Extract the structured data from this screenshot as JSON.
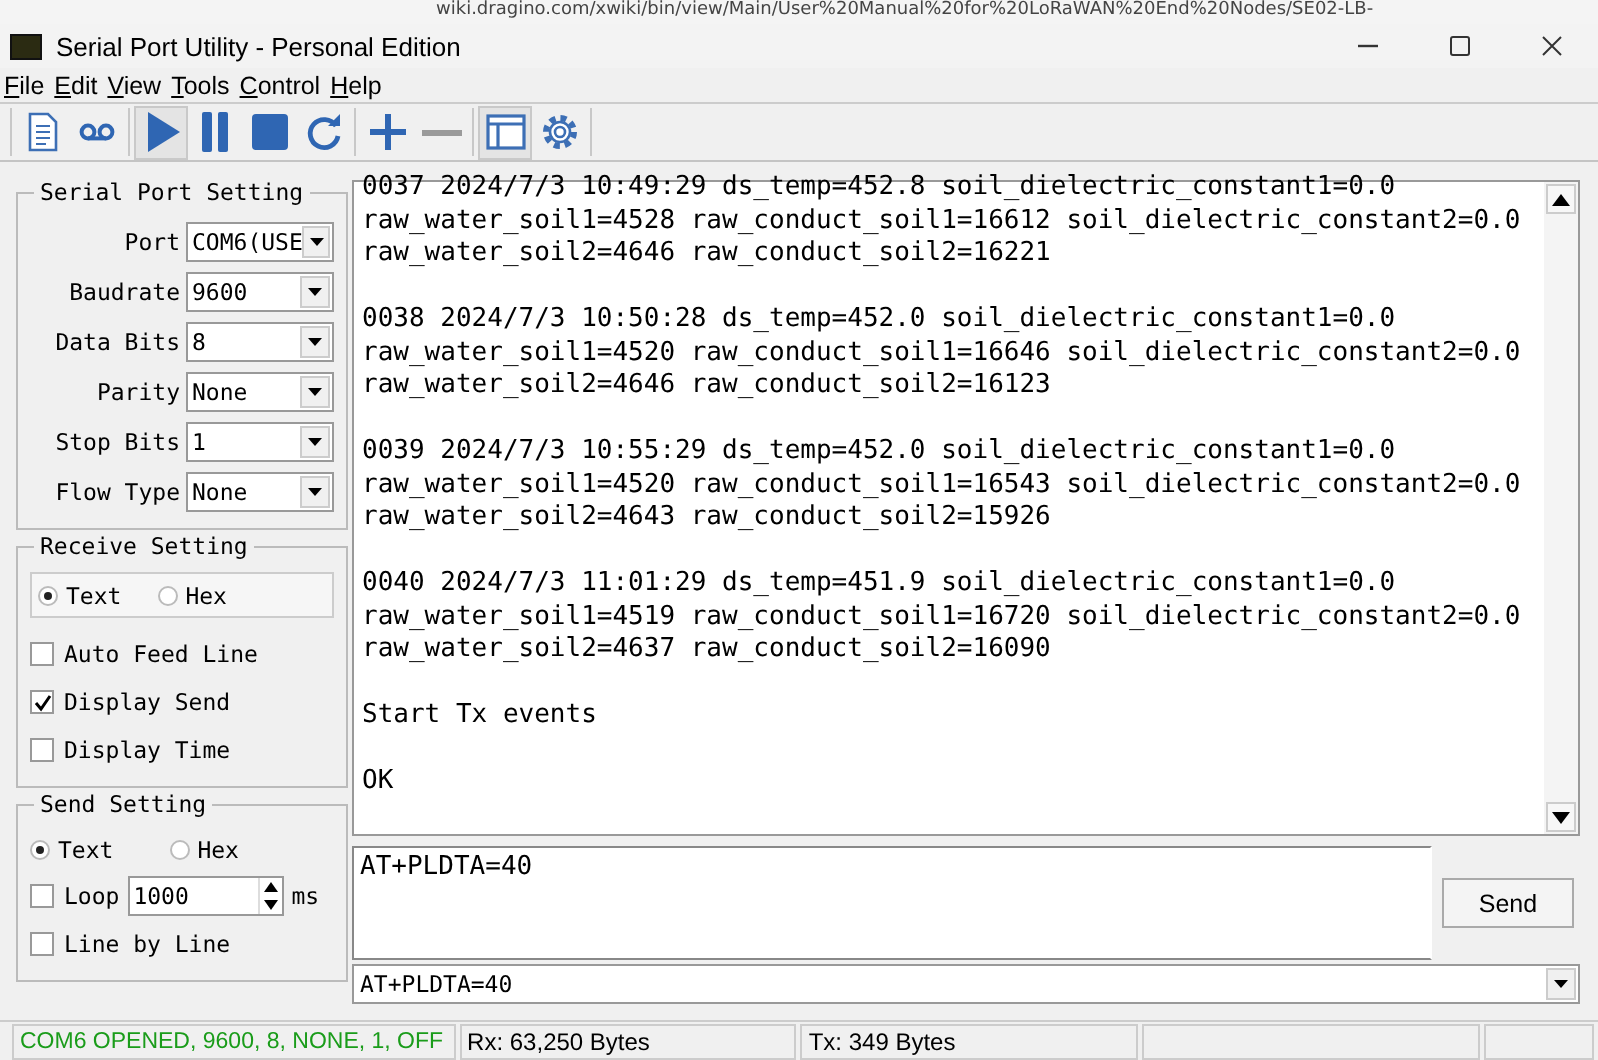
{
  "background": {
    "url": "wiki.dragino.com/xwiki/bin/view/Main/User%20Manual%20for%20LoRaWAN%20End%20Nodes/SE02-LB-"
  },
  "window": {
    "title": "Serial Port Utility - Personal Edition"
  },
  "menu": [
    {
      "label": "File"
    },
    {
      "label": "Edit"
    },
    {
      "label": "View"
    },
    {
      "label": "Tools"
    },
    {
      "label": "Control"
    },
    {
      "label": "Help"
    }
  ],
  "toolbar": [
    [
      {
        "kind": "document",
        "pressed": false
      },
      {
        "kind": "voicemail",
        "pressed": false
      }
    ],
    [
      {
        "kind": "play",
        "pressed": true
      },
      {
        "kind": "pause",
        "pressed": false
      },
      {
        "kind": "stop",
        "pressed": false
      },
      {
        "kind": "refresh",
        "pressed": false
      }
    ],
    [
      {
        "kind": "plus",
        "pressed": false
      },
      {
        "kind": "minus",
        "pressed": false
      }
    ],
    [
      {
        "kind": "window",
        "pressed": true
      },
      {
        "kind": "gear",
        "pressed": false
      }
    ]
  ],
  "serial_port_setting": {
    "title": "Serial Port Setting",
    "fields": [
      {
        "label": "Port",
        "value": "COM6(USE"
      },
      {
        "label": "Baudrate",
        "value": "9600"
      },
      {
        "label": "Data Bits",
        "value": "8"
      },
      {
        "label": "Parity",
        "value": "None"
      },
      {
        "label": "Stop Bits",
        "value": "1"
      },
      {
        "label": "Flow Type",
        "value": "None"
      }
    ]
  },
  "receive_setting": {
    "title": "Receive Setting",
    "format": [
      {
        "label": "Text",
        "selected": true
      },
      {
        "label": "Hex",
        "selected": false
      }
    ],
    "options": [
      {
        "label": "Auto Feed Line",
        "checked": false
      },
      {
        "label": "Display Send",
        "checked": true
      },
      {
        "label": "Display Time",
        "checked": false
      }
    ]
  },
  "send_setting": {
    "title": "Send Setting",
    "format": [
      {
        "label": "Text",
        "selected": true
      },
      {
        "label": "Hex",
        "selected": false
      }
    ],
    "loop": {
      "label": "Loop",
      "checked": false,
      "value": "1000",
      "unit": "ms"
    },
    "line_by_line": {
      "label": "Line by Line",
      "checked": false
    }
  },
  "log": [
    [
      "0037 2024/7/3 10:49:29 ds_temp=452.8 soil_dielectric_constant1=0.0",
      "raw_water_soil1=4528 raw_conduct_soil1=16612 soil_dielectric_constant2=0.0",
      "raw_water_soil2=4646 raw_conduct_soil2=16221"
    ],
    [
      "0038 2024/7/3 10:50:28 ds_temp=452.0 soil_dielectric_constant1=0.0",
      "raw_water_soil1=4520 raw_conduct_soil1=16646 soil_dielectric_constant2=0.0",
      "raw_water_soil2=4646 raw_conduct_soil2=16123"
    ],
    [
      "0039 2024/7/3 10:55:29 ds_temp=452.0 soil_dielectric_constant1=0.0",
      "raw_water_soil1=4520 raw_conduct_soil1=16543 soil_dielectric_constant2=0.0",
      "raw_water_soil2=4643 raw_conduct_soil2=15926"
    ],
    [
      "0040 2024/7/3 11:01:29 ds_temp=451.9 soil_dielectric_constant1=0.0",
      "raw_water_soil1=4519 raw_conduct_soil1=16720 soil_dielectric_constant2=0.0",
      "raw_water_soil2=4637 raw_conduct_soil2=16090"
    ],
    [
      "Start Tx events"
    ],
    [
      "OK"
    ]
  ],
  "send_input": {
    "value": "AT+PLDTA=40"
  },
  "send_button": {
    "label": "Send"
  },
  "history": {
    "value": "AT+PLDTA=40"
  },
  "status_bar": [
    {
      "text": "COM6 OPENED, 9600, 8, NONE, 1, OFF",
      "kind": "connection"
    },
    {
      "text": "Rx: 63,250 Bytes",
      "kind": "plain"
    },
    {
      "text": "Tx: 349 Bytes",
      "kind": "plain"
    }
  ]
}
